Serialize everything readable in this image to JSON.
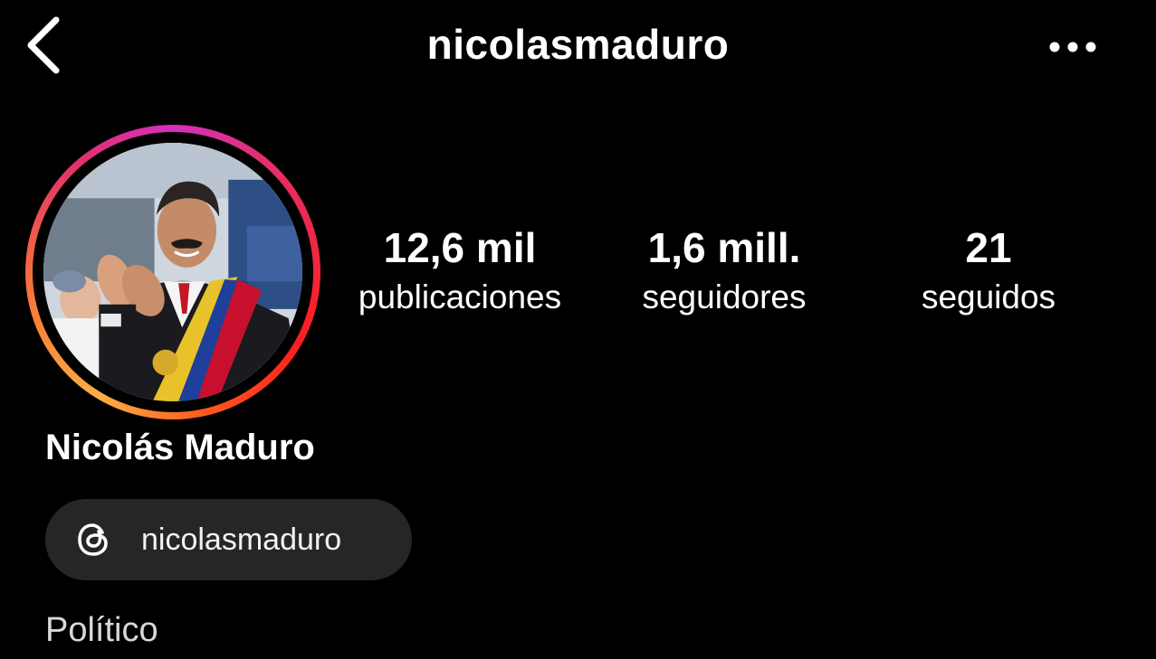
{
  "header": {
    "username": "nicolasmaduro",
    "back_icon": "chevron-left-icon",
    "more_icon": "more-horizontal-icon"
  },
  "profile": {
    "avatar": "profile-photo",
    "story_ring_colors": [
      "#d62fbf",
      "#e1306c",
      "#fd1d1d",
      "#fcaf45"
    ],
    "display_name": "Nicolás Maduro",
    "category": "Político"
  },
  "stats": {
    "posts": {
      "value": "12,6 mil",
      "label": "publicaciones"
    },
    "followers": {
      "value": "1,6 mill.",
      "label": "seguidores"
    },
    "following": {
      "value": "21",
      "label": "seguidos"
    }
  },
  "threads": {
    "icon": "threads-icon",
    "handle": "nicolasmaduro"
  }
}
